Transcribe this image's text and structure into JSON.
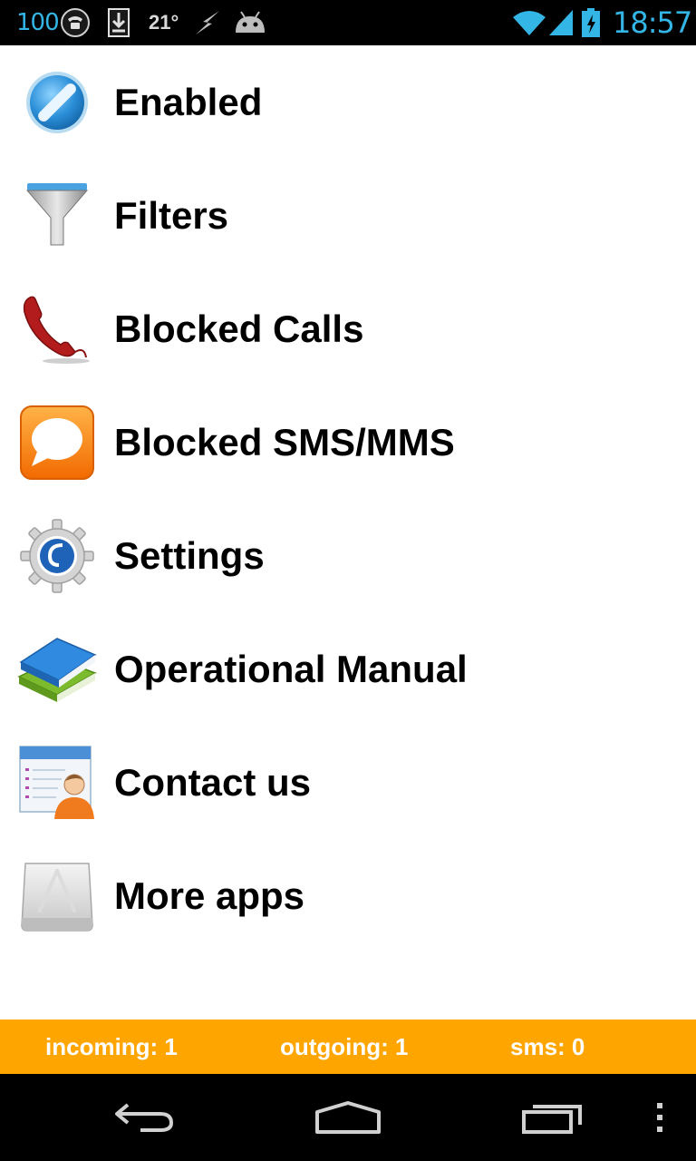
{
  "status_bar": {
    "battery_level": "100",
    "temperature": "21°",
    "time": "18:57",
    "accent_color": "#33b5e5",
    "icons": [
      "phone-icon",
      "download-icon",
      "flash-icon",
      "android-icon",
      "wifi-icon",
      "signal-icon",
      "battery-icon"
    ]
  },
  "menu": {
    "items": [
      {
        "label": "Enabled",
        "icon": "enabled-icon"
      },
      {
        "label": "Filters",
        "icon": "funnel-icon"
      },
      {
        "label": "Blocked Calls",
        "icon": "phone-handset-icon"
      },
      {
        "label": "Blocked SMS/MMS",
        "icon": "speech-bubble-icon"
      },
      {
        "label": "Settings",
        "icon": "gear-icon"
      },
      {
        "label": "Operational Manual",
        "icon": "books-icon"
      },
      {
        "label": "Contact us",
        "icon": "contact-card-icon"
      },
      {
        "label": "More apps",
        "icon": "app-store-icon"
      }
    ]
  },
  "counters": {
    "incoming": "incoming: 1",
    "outgoing": "outgoing: 1",
    "sms": "sms: 0",
    "background_color": "#ffa500"
  },
  "nav_bar": {
    "icons": [
      "back-icon",
      "home-icon",
      "recent-apps-icon",
      "overflow-menu-icon"
    ]
  }
}
